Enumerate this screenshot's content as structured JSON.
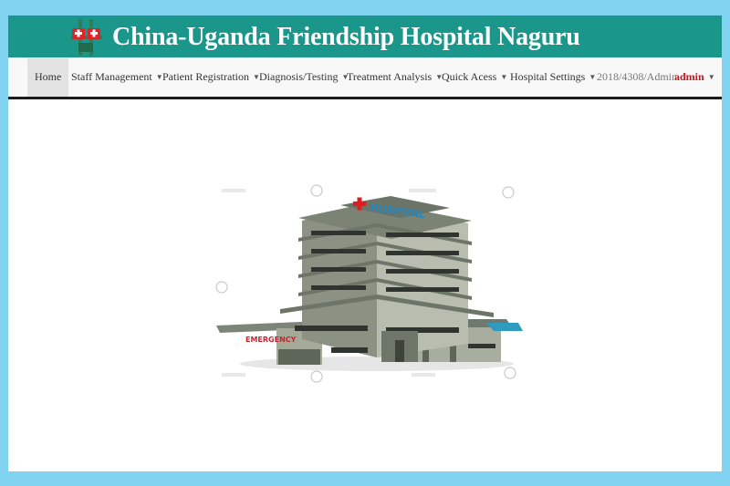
{
  "header": {
    "title": "China-Uganda Friendship Hospital Naguru",
    "logo_icon": "hospital-cross-logo-icon",
    "background_color": "#1a968a"
  },
  "navbar": {
    "items": [
      {
        "label": "Home",
        "active": true
      },
      {
        "label": "Staff Management",
        "dropdown": true
      },
      {
        "label": "Patient Registration",
        "dropdown": true
      },
      {
        "label": "Diagnosis/Testing",
        "dropdown": true
      },
      {
        "label": "Treatment Analysis",
        "dropdown": true
      },
      {
        "label": "Quick Acess",
        "dropdown": true
      },
      {
        "label": "Hospital Settings",
        "dropdown": true
      }
    ],
    "user_id": "2018/4308/Admin",
    "user_menu": "admin",
    "caret_icon": "caret-down-icon"
  },
  "hero": {
    "image": "hospital-building-illustration",
    "sign_top": "HOSPITAL",
    "sign_side": "EMERGENCY"
  },
  "colors": {
    "page_background": "#7fd3f0",
    "accent": "#1a968a",
    "user_text": "#c0161c"
  }
}
